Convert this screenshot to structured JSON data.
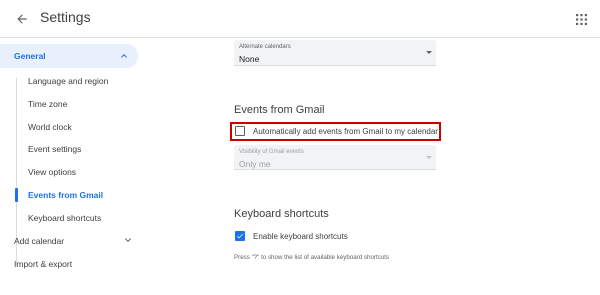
{
  "header": {
    "title": "Settings",
    "back_icon": "arrow-back-icon",
    "apps_icon": "apps-grid-icon"
  },
  "sidebar": {
    "general_label": "General",
    "items": [
      {
        "label": "Language and region",
        "active": false
      },
      {
        "label": "Time zone",
        "active": false
      },
      {
        "label": "World clock",
        "active": false
      },
      {
        "label": "Event settings",
        "active": false
      },
      {
        "label": "View options",
        "active": false
      },
      {
        "label": "Events from Gmail",
        "active": true
      },
      {
        "label": "Keyboard shortcuts",
        "active": false
      }
    ],
    "add_calendar_label": "Add calendar",
    "import_export_label": "Import & export"
  },
  "main": {
    "alternate_calendars": {
      "caption": "Alternate calendars",
      "value": "None"
    },
    "events_from_gmail": {
      "title": "Events from Gmail",
      "auto_add_label": "Automatically add events from Gmail to my calendar",
      "auto_add_checked": false,
      "visibility": {
        "caption": "Visibility of Gmail events",
        "value": "Only me"
      }
    },
    "keyboard_shortcuts": {
      "title": "Keyboard shortcuts",
      "enable_label": "Enable keyboard shortcuts",
      "enable_checked": true,
      "hint": "Press \"?\" to show the list of available keyboard shortcuts"
    }
  },
  "colors": {
    "accent": "#1a73e8",
    "highlight": "#cc0000",
    "active_bg": "#e8f0fe"
  }
}
